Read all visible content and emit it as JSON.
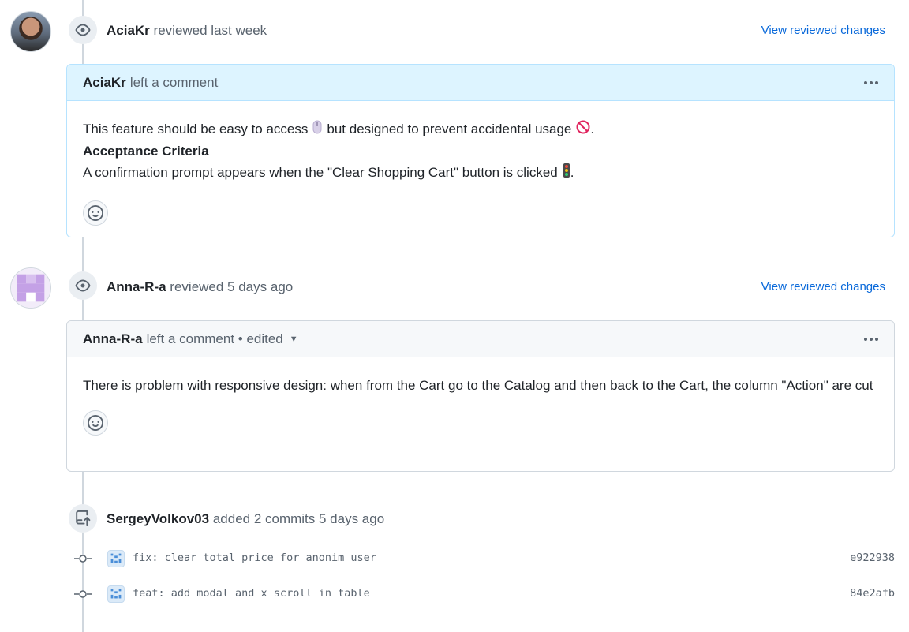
{
  "events": [
    {
      "author": "AciaKr",
      "action": "reviewed last week",
      "link": "View reviewed changes",
      "comment": {
        "author": "AciaKr",
        "action": "left a comment",
        "line1_a": "This feature should be easy to access",
        "line1_b": "but designed to prevent accidental usage",
        "line1_end": ".",
        "heading": "Acceptance Criteria",
        "line3": "A confirmation prompt appears when the \"Clear Shopping Cart\" button is clicked",
        "line3_end": "."
      }
    },
    {
      "author": "Anna-R-a",
      "action": "reviewed 5 days ago",
      "link": "View reviewed changes",
      "comment": {
        "author": "Anna-R-a",
        "action": "left a comment • edited",
        "body": "There is problem with responsive design: when from the Cart go to the Catalog and then back to the Cart, the column \"Action\" are cut"
      }
    }
  ],
  "commits_event": {
    "author": "SergeyVolkov03",
    "action": "added 2 commits 5 days ago",
    "commits": [
      {
        "message": "fix: clear total price for anonim user",
        "sha": "e922938"
      },
      {
        "message": "feat: add modal and x scroll in table",
        "sha": "84e2afb"
      }
    ]
  },
  "icons": {
    "review": "eye-icon",
    "commits": "repo-push-icon",
    "reaction": "smiley-icon",
    "commit_node": "git-commit-icon",
    "more": "kebab-horizontal-icon",
    "emoji1": "mouse-emoji",
    "emoji2": "prohibited-emoji",
    "emoji3": "traffic-light-emoji"
  },
  "colors": {
    "link": "#0969da",
    "highlight_header": "#ddf4ff",
    "highlight_border": "#b6e3ff",
    "timeline": "#d0d7de"
  }
}
